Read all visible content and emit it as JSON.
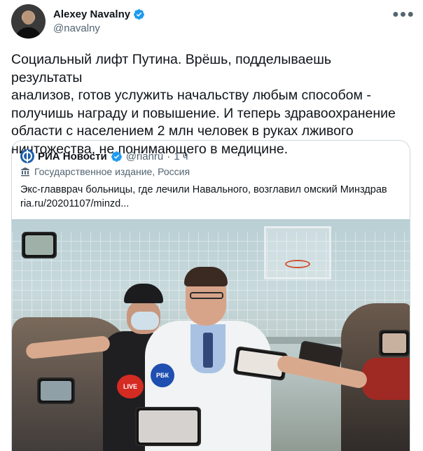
{
  "author": {
    "display_name": "Alexey Navalny",
    "handle": "@navalny"
  },
  "tweet": {
    "text": "Социальный лифт Путина. Врёшь, подделываешь результаты\nанализов, готов услужить начальству любым способом -\nполучишь награду и повышение. И теперь здравоохранение\nобласти с населением 2 млн человек в руках лживого\nничтожества, не понимающего в медицине."
  },
  "quoted": {
    "name": "РИА Новости",
    "handle": "@rianru",
    "dot": "·",
    "time": "1 ч",
    "affiliation": "Государственное издание, Россия",
    "text": "Экс-главврач больницы, где лечили Навального, возглавил омский Минздрав",
    "link": "ria.ru/20201107/minzd..."
  },
  "mic_labels": {
    "rbk": "РБК",
    "live": "LIVE"
  },
  "colors": {
    "verified_blue": "#1d9bf0",
    "secondary_text": "#536471",
    "border": "#cfd9de",
    "ria_blue": "#1d5fa8"
  },
  "icons": {
    "more": "more-dots-icon",
    "verified": "verified-badge-icon",
    "affiliation": "government-building-icon"
  }
}
